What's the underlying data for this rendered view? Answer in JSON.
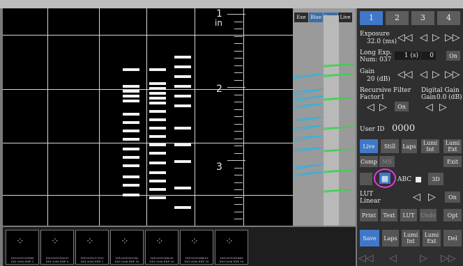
{
  "histogram": {
    "buttons": [
      "Exe",
      "Blue",
      "Green",
      "Live"
    ]
  },
  "ruler": {
    "unit": "in",
    "numbers": [
      "1",
      "2",
      "3"
    ]
  },
  "panel": {
    "tabs": [
      "1",
      "2",
      "3",
      "4"
    ],
    "exposure": {
      "label": "Exposure",
      "value": "32.0 (ms)"
    },
    "long_exp": {
      "label": "Long Exp.",
      "sub": "Num: 037",
      "value1": "1 (s)",
      "value2": "0",
      "toggle": "On"
    },
    "gain": {
      "label": "Gain",
      "value": "20 (dB)"
    },
    "recursive_filter": {
      "label": "Recursive Filter",
      "factor_label": "Factor",
      "factor_value": "1",
      "toggle": "On"
    },
    "digital_gain": {
      "label": "Digital Gain",
      "gain_label": "Gain",
      "value": "0.0 (dB)"
    },
    "user_id": {
      "label": "User ID",
      "value": "0000"
    },
    "buttons1": {
      "live": "Live",
      "still": "Still",
      "laps": "Laps",
      "lumi_int": "Lumi Int",
      "lumi_ext": "Lumi Ext"
    },
    "buttons2": {
      "comp": "Comp",
      "ms": "MS",
      "exit": "Exit"
    },
    "grid_row": {
      "abc": "ABC",
      "three_d": "3D"
    },
    "lut": {
      "label": "LUT",
      "value": "Linear",
      "toggle": "On"
    },
    "print_row": {
      "print": "Print",
      "text": "Text",
      "lut": "LUT",
      "undo": "Undo",
      "opt": "Opt"
    },
    "save_row": {
      "save": "Save",
      "laps": "Laps",
      "lumi_int": "Lumi Int",
      "lumi_ext": "Lumi Ext",
      "del": "Del"
    }
  },
  "thumbnails": [
    {
      "id": "1610291519985",
      "caption": "DSI-2006 EXP 1"
    },
    {
      "id": "1610291518297",
      "caption": "DSI-2006 EXP 8"
    },
    {
      "id": "1610291517553",
      "caption": "DSI-2006 EXP 1"
    },
    {
      "id": "1610291505182",
      "caption": "DSI-2006 EXP 16"
    },
    {
      "id": "1610291504039",
      "caption": "DSI-2006 EXP 16"
    },
    {
      "id": "1610291504019",
      "caption": "DSI-2006 EXP 16"
    },
    {
      "id": "1610291501469",
      "caption": "DSI-2006 EXP 16"
    }
  ]
}
